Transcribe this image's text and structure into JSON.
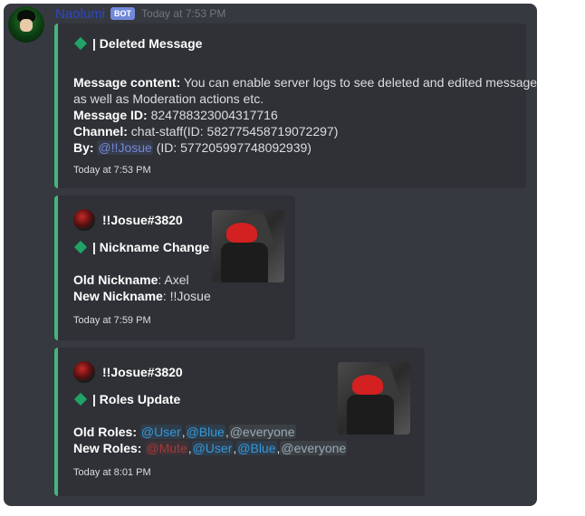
{
  "bot": {
    "username": "Naolumi",
    "badge": "BOT",
    "timestamp": "Today at 7:53 PM"
  },
  "embeds": [
    {
      "title": "| Deleted Message",
      "fields": {
        "content_label": "Message content:",
        "content_value": "You can enable server logs to see deleted and edited messages",
        "content_value_2": "as well as Moderation actions etc.",
        "id_label": "Message ID:",
        "id_value": "824788323004317716",
        "channel_label": "Channel:",
        "channel_value": "chat-staff(ID: 582775458719072297)",
        "by_label": "By:",
        "by_mention": "@!!Josue",
        "by_value": "(ID: 577205997748092939)"
      },
      "footer": "Today at 7:53 PM",
      "accent": "#43b581"
    },
    {
      "author": "!!Josue#3820",
      "title": "| Nickname Change",
      "fields": {
        "old_label": "Old Nickname",
        "old_value": ": Axel",
        "new_label": "New Nickname",
        "new_value": ": !!Josue"
      },
      "footer": "Today at 7:59 PM"
    },
    {
      "author": "!!Josue#3820",
      "title": "| Roles Update",
      "fields": {
        "old_label": "Old Roles:",
        "old_roles": [
          "@User",
          "@Blue",
          "@everyone"
        ],
        "new_label": "New Roles:",
        "new_roles": [
          "@Mute",
          "@User",
          "@Blue",
          "@everyone"
        ]
      },
      "footer": "Today at 8:01 PM"
    }
  ],
  "colors": {
    "background": "#36393f",
    "embed_bg": "#2f3136",
    "embed_accent": "#43b581",
    "username": "#2f48c6",
    "mention": "#7289da",
    "mute_role": "#a33a3a"
  },
  "icons": {
    "avatar": "bot-avatar",
    "diamond": "green-diamond-icon",
    "author_avatar": "user-avatar"
  }
}
